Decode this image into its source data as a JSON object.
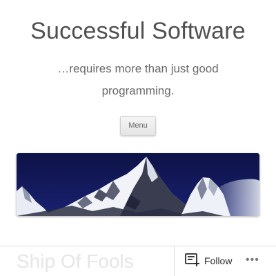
{
  "site": {
    "title": "Successful Software",
    "description": "…requires more than just good programming."
  },
  "nav": {
    "menu_label": "Menu"
  },
  "header_image": {
    "icon": "mountain-photo"
  },
  "post": {
    "title": "Ship Of Fools"
  },
  "actions": {
    "follow_label": "Follow",
    "follow_icon": "reader-follow-icon",
    "more_icon": "more-dots-icon",
    "more_glyph": "•••"
  },
  "colors": {
    "sky": "#141a55",
    "title_text": "#4f4f4f"
  }
}
